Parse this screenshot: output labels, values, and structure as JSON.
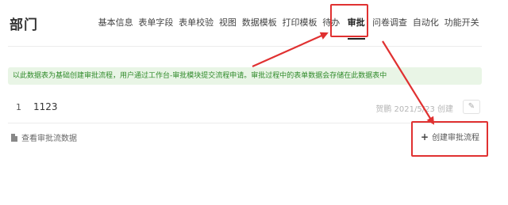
{
  "header": {
    "title": "部门",
    "tabs": [
      {
        "label": "基本信息"
      },
      {
        "label": "表单字段"
      },
      {
        "label": "表单校验"
      },
      {
        "label": "视图"
      },
      {
        "label": "数据模板"
      },
      {
        "label": "打印模板"
      },
      {
        "label": "待办"
      },
      {
        "label": "审批",
        "active": true
      },
      {
        "label": "问卷调查"
      },
      {
        "label": "自动化"
      },
      {
        "label": "功能开关"
      }
    ]
  },
  "info_bar": {
    "text": "以此数据表为基础创建审批流程，用户通过工作台-审批模块提交流程申请。审批过程中的表单数据会存储在此数据表中"
  },
  "list": {
    "rows": [
      {
        "index": "1",
        "name": "1123",
        "meta": "贺鹏 2021/5/23 创建",
        "edit_icon": "edit-icon"
      }
    ]
  },
  "footer": {
    "view_link_label": "查看审批流数据",
    "create_button_label": "创建审批流程"
  },
  "colors": {
    "accent": "#2f8a2a",
    "info_bg": "#e9f5e6",
    "annotation": "#e03131"
  }
}
